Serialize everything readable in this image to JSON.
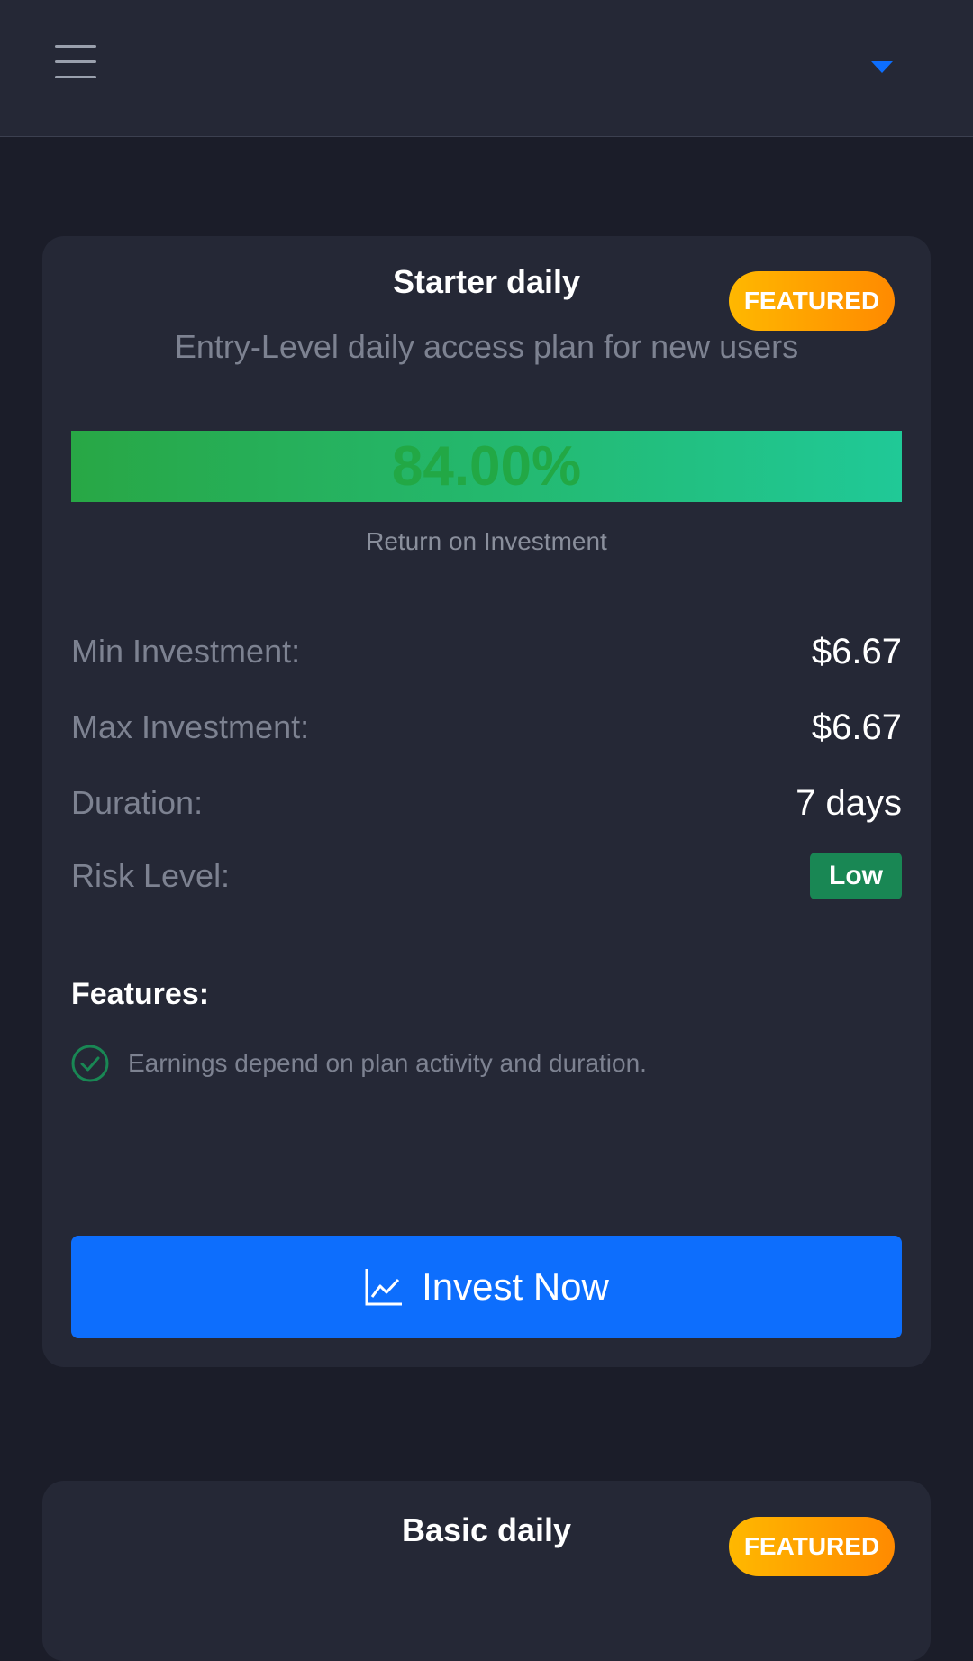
{
  "header": {
    "menu_icon": "hamburger-icon",
    "dropdown_icon": "caret-down-icon"
  },
  "plans": [
    {
      "title": "Starter daily",
      "badge": "FEATURED",
      "subtitle": "Entry-Level daily access plan for new users",
      "roi": {
        "value": "84.00%",
        "label": "Return on Investment"
      },
      "details": {
        "min_label": "Min Investment:",
        "min_value": "$6.67",
        "max_label": "Max Investment:",
        "max_value": "$6.67",
        "duration_label": "Duration:",
        "duration_value": "7 days",
        "risk_label": "Risk Level:",
        "risk_value": "Low"
      },
      "features_title": "Features:",
      "features": [
        {
          "icon": "check-circle-icon",
          "text": "Earnings depend on plan activity and duration."
        }
      ],
      "cta": {
        "icon": "chart-line-icon",
        "label": "Invest Now"
      }
    },
    {
      "title": "Basic daily",
      "badge": "FEATURED"
    }
  ],
  "colors": {
    "background": "#1b1d29",
    "card": "#252836",
    "primary": "#0d6efd",
    "success": "#198754",
    "badge_gradient": [
      "#ffb800",
      "#ff8a00"
    ],
    "roi_gradient": [
      "#28a745",
      "#20c997"
    ]
  }
}
